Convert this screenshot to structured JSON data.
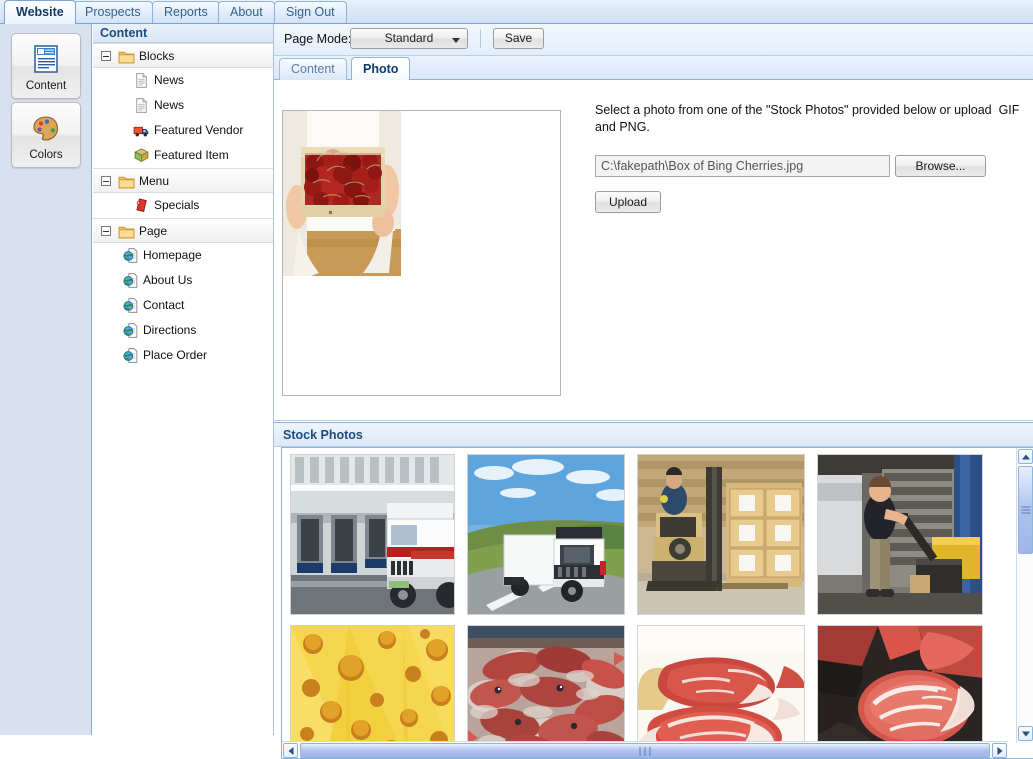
{
  "top_tabs": [
    {
      "label": "Website",
      "active": true
    },
    {
      "label": "Prospects",
      "active": false
    },
    {
      "label": "Reports",
      "active": false
    },
    {
      "label": "About",
      "active": false
    },
    {
      "label": "Sign Out",
      "active": false
    }
  ],
  "rail": {
    "buttons": [
      {
        "label": "Content",
        "icon": "document-content-icon"
      },
      {
        "label": "Colors",
        "icon": "color-palette-icon"
      }
    ]
  },
  "tree": {
    "header": "Content",
    "nodes": [
      {
        "label": "Blocks",
        "type": "folder",
        "icon": "folder-icon",
        "expanded": true,
        "depth": 0
      },
      {
        "label": "News",
        "type": "item",
        "icon": "page-document-icon",
        "depth": 1
      },
      {
        "label": "News",
        "type": "item",
        "icon": "page-document-icon",
        "depth": 1
      },
      {
        "label": "Featured Vendor",
        "type": "item",
        "icon": "truck-icon",
        "depth": 1
      },
      {
        "label": "Featured Item",
        "type": "item",
        "icon": "box-package-icon",
        "depth": 1
      },
      {
        "label": "Menu",
        "type": "folder",
        "icon": "folder-icon",
        "expanded": true,
        "depth": 0
      },
      {
        "label": "Specials",
        "type": "item",
        "icon": "price-tag-icon",
        "depth": 1
      },
      {
        "label": "Page",
        "type": "folder",
        "icon": "folder-icon",
        "expanded": true,
        "depth": 0
      },
      {
        "label": "Homepage",
        "type": "item",
        "icon": "web-page-icon",
        "depth": 1
      },
      {
        "label": "About Us",
        "type": "item",
        "icon": "web-page-icon",
        "depth": 1
      },
      {
        "label": "Contact",
        "type": "item",
        "icon": "web-page-icon",
        "depth": 1
      },
      {
        "label": "Directions",
        "type": "item",
        "icon": "web-page-icon",
        "depth": 1
      },
      {
        "label": "Place Order",
        "type": "item",
        "icon": "web-page-icon",
        "depth": 1
      }
    ]
  },
  "toolbar": {
    "page_mode_label": "Page Mode:",
    "page_mode_value": "Standard",
    "save_label": "Save"
  },
  "sub_tabs": [
    {
      "label": "Content",
      "active": false
    },
    {
      "label": "Photo",
      "active": true
    }
  ],
  "photo": {
    "help_text": "Select a photo from one of the \"Stock Photos\" provided below or upload  GIF and PNG.",
    "file_value": "C:\\fakepath\\Box of Bing Cherries.jpg",
    "browse_label": "Browse...",
    "upload_label": "Upload",
    "preview_alt": "box-of-bing-cherries-photo"
  },
  "stock": {
    "header": "Stock Photos",
    "thumbs": [
      {
        "name": "trucks-at-loading-dock"
      },
      {
        "name": "white-delivery-truck-on-road"
      },
      {
        "name": "forklift-moving-boxes-in-warehouse"
      },
      {
        "name": "worker-with-pallet-jack-at-dock"
      },
      {
        "name": "swiss-cheese-slices"
      },
      {
        "name": "fresh-red-fish-on-ice"
      },
      {
        "name": "raw-beef-steaks"
      },
      {
        "name": "marbled-ribeye-steak"
      }
    ]
  },
  "colors": {
    "accent_blue": "#1c4b82",
    "tab_border": "#8fb4da",
    "rail_bg": "#d7e1f0",
    "scrollbar_thumb": "#aec2ee"
  }
}
